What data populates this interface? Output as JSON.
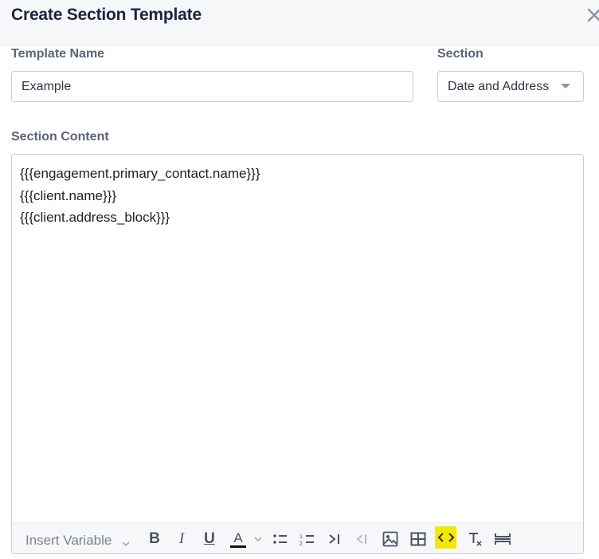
{
  "dialog": {
    "title": "Create Section Template"
  },
  "template_name": {
    "label": "Template Name",
    "value": "Example"
  },
  "section": {
    "label": "Section",
    "selected": "Date and Address"
  },
  "section_content": {
    "label": "Section Content",
    "lines": [
      "{{{engagement.primary_contact.name}}}",
      "{{{client.name}}}",
      "{{{client.address_block}}}"
    ]
  },
  "toolbar": {
    "insert_variable_label": "Insert Variable",
    "bold": "B",
    "italic": "I",
    "underline": "U",
    "font_color": "A",
    "icons": [
      "bold-icon",
      "italic-icon",
      "underline-icon",
      "font-color-icon",
      "bullet-list-icon",
      "numbered-list-icon",
      "indent-icon",
      "outdent-icon",
      "image-icon",
      "table-icon",
      "code-icon",
      "clear-format-icon",
      "horizontal-rule-icon"
    ],
    "highlight_color": "#f5e800"
  }
}
